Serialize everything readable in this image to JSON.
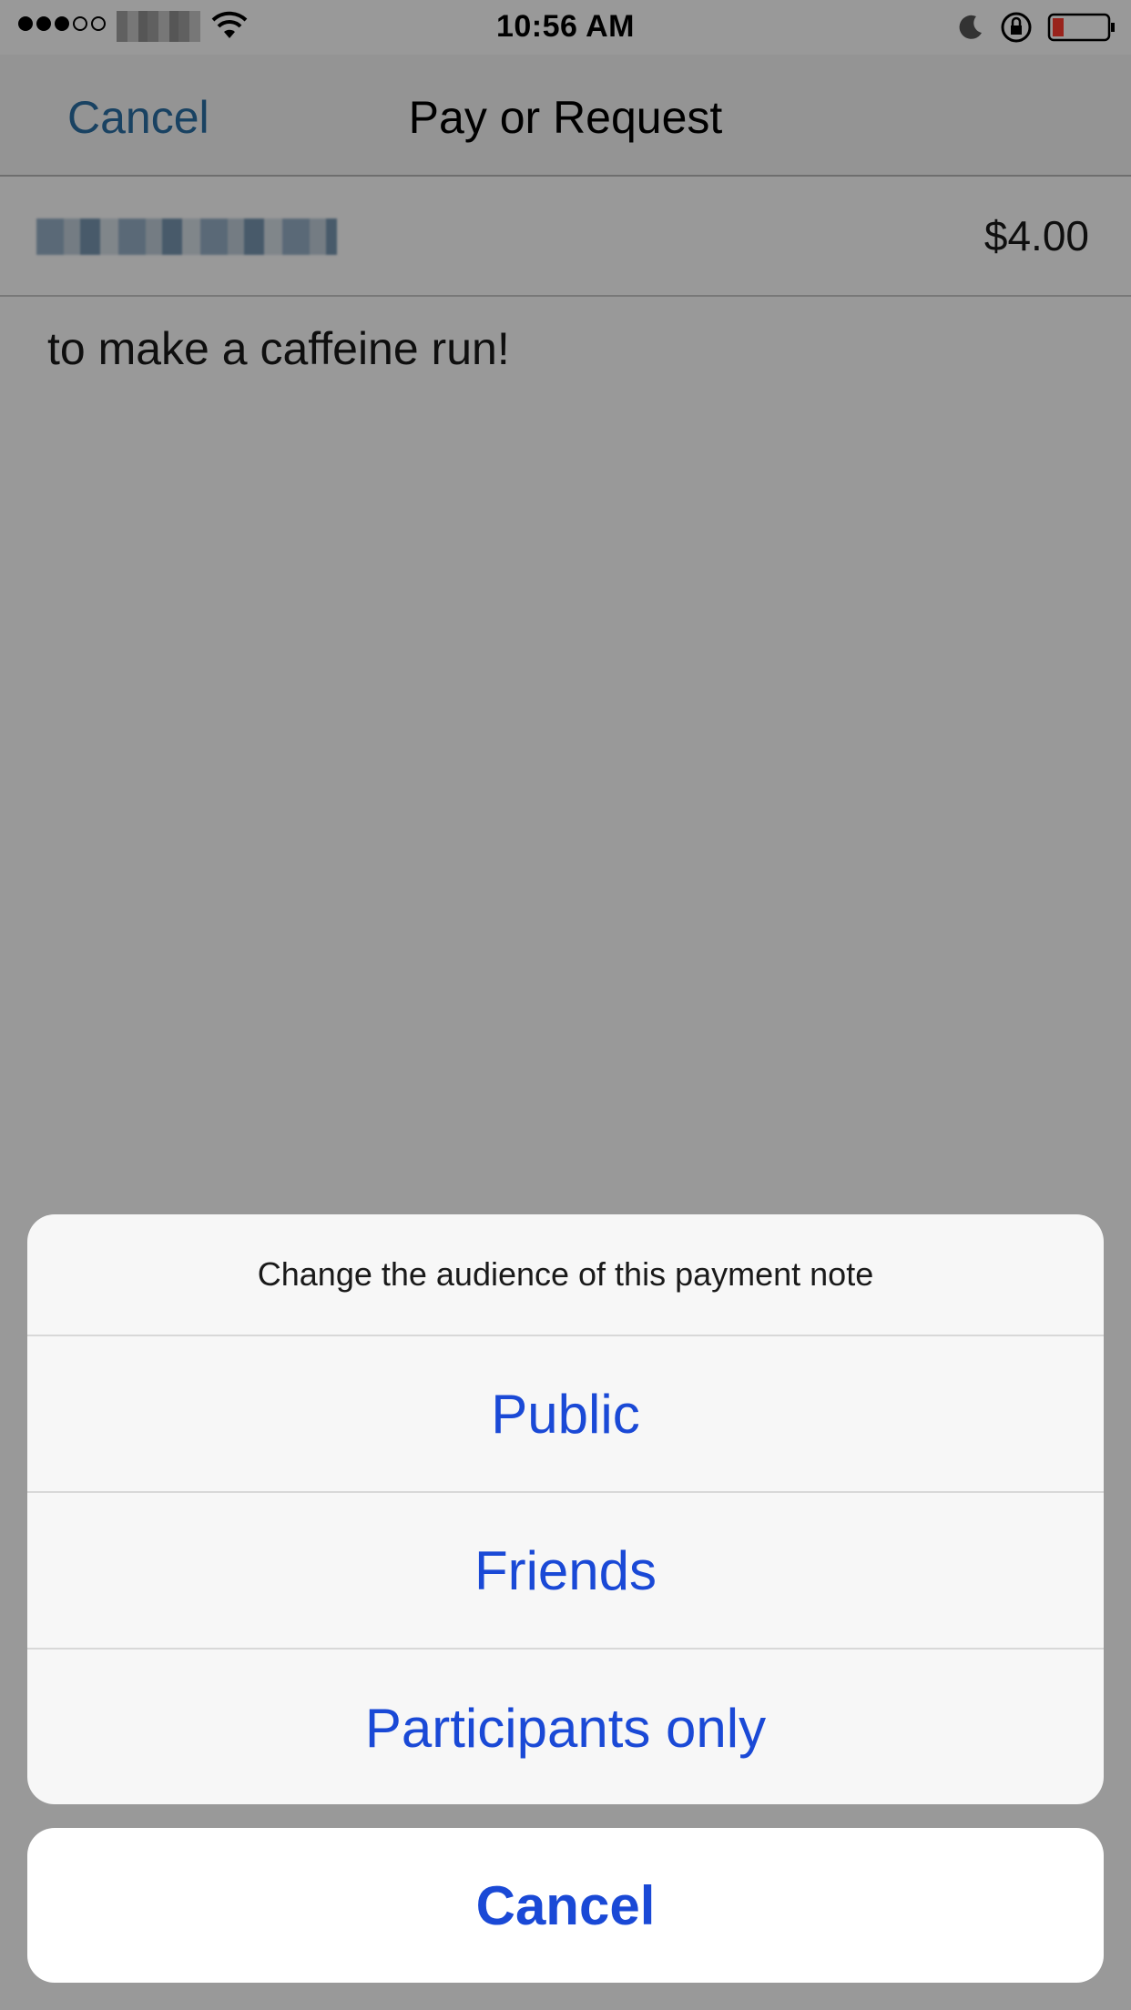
{
  "status_bar": {
    "signal_dots": [
      "full",
      "full",
      "full",
      "empty",
      "empty"
    ],
    "time": "10:56 AM",
    "icons": [
      "wifi-icon",
      "moon-icon",
      "rotation-lock-icon",
      "battery-icon"
    ],
    "battery_color": "#ff3b30"
  },
  "nav": {
    "cancel_label": "Cancel",
    "title": "Pay or Request"
  },
  "payment": {
    "amount": "$4.00",
    "note": "to make a caffeine run!"
  },
  "action_sheet": {
    "title": "Change the audience of this payment note",
    "options": [
      "Public",
      "Friends",
      "Participants only"
    ],
    "cancel_label": "Cancel"
  },
  "colors": {
    "accent": "#1a49d6",
    "nav_link": "#2b6ea3"
  }
}
